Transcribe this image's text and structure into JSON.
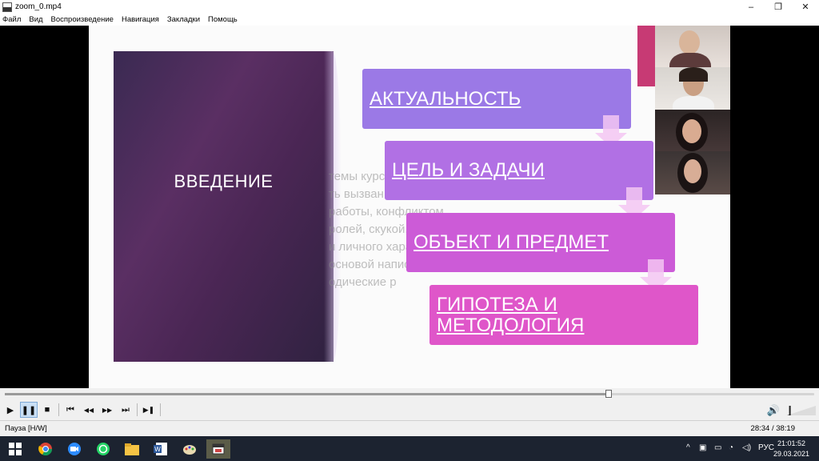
{
  "window": {
    "title": "zoom_0.mp4",
    "minimize": "–",
    "restore": "❐",
    "close": "✕"
  },
  "menu": [
    "Файл",
    "Вид",
    "Воспроизведение",
    "Навигация",
    "Закладки",
    "Помощь"
  ],
  "slide": {
    "left_title": "ВВЕДЕНИЕ",
    "ghost_text": "темы курсовой раб\nть вызван слишком бо\nработы, конфликтом\nролей, скукой, физич\nи личного характе\nосновой написан\nодические р",
    "boxes": [
      {
        "label": "АКТУАЛЬНОСТЬ",
        "color": "#9b79e6"
      },
      {
        "label": "ЦЕЛЬ И ЗАДАЧИ",
        "color": "#b170e4"
      },
      {
        "label": "ОБЪЕКТ И ПРЕДМЕТ",
        "color": "#cc5bd7"
      },
      {
        "label": "ГИПОТЕЗА И\nМЕТОДОЛОГИЯ",
        "color": "#df56c9"
      }
    ]
  },
  "player": {
    "progress": 0.746,
    "buttons": {
      "play": "▶",
      "pause": "❚❚",
      "stop": "■",
      "prev": "⏮",
      "rewind": "◀◀",
      "forward": "▶▶",
      "next": "⏭",
      "frame": "▶❚"
    },
    "volume_icon": "🔊",
    "volume": 0.1
  },
  "status": {
    "left": "Пауза [H/W]",
    "right": "28:34 / 38:19"
  },
  "taskbar": {
    "apps": [
      "windows-icon",
      "chrome-icon",
      "zoom-icon",
      "whatsapp-icon",
      "file-explorer-icon",
      "word-icon",
      "paint-icon",
      "media-player-icon"
    ],
    "tray_lang": "РУС",
    "tray_arrow": "^",
    "time": "21:01:52",
    "date": "29.03.2021"
  }
}
